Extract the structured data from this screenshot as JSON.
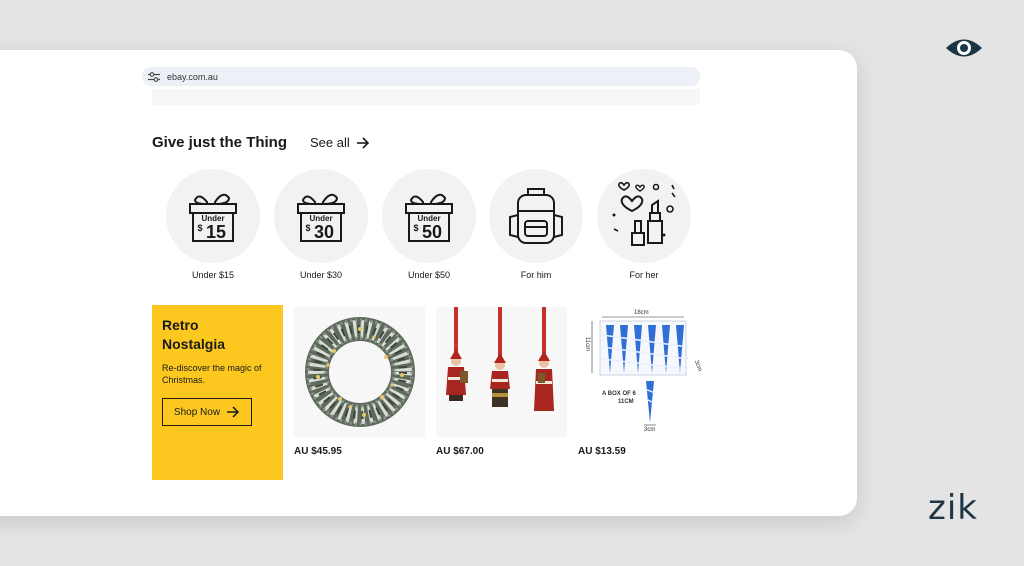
{
  "browser": {
    "url": "ebay.com.au"
  },
  "section": {
    "title": "Give just the Thing",
    "see_all": "See all"
  },
  "categories": [
    {
      "label": "Under $15",
      "badge_top": "Under",
      "badge_amount": "15"
    },
    {
      "label": "Under $30",
      "badge_top": "Under",
      "badge_amount": "30"
    },
    {
      "label": "Under $50",
      "badge_top": "Under",
      "badge_amount": "50"
    },
    {
      "label": "For him"
    },
    {
      "label": "For her"
    }
  ],
  "promo": {
    "title": "Retro Nostalgia",
    "text": "Re-discover the magic of Christmas.",
    "button": "Shop Now",
    "color": "#fcc81f"
  },
  "products": [
    {
      "price": "AU $45.95",
      "image": "christmas-wreath"
    },
    {
      "price": "AU $67.00",
      "image": "santa-ornaments"
    },
    {
      "price": "AU $13.59",
      "image": "blue-icicle-ornaments",
      "dims": {
        "width": "18cm",
        "height": "11cm",
        "depth": "3cm",
        "box": "A BOX OF 6",
        "length": "11CM",
        "small": "3cm"
      }
    }
  ],
  "brand": {
    "watermark": "zik",
    "color": "#1d3545"
  }
}
